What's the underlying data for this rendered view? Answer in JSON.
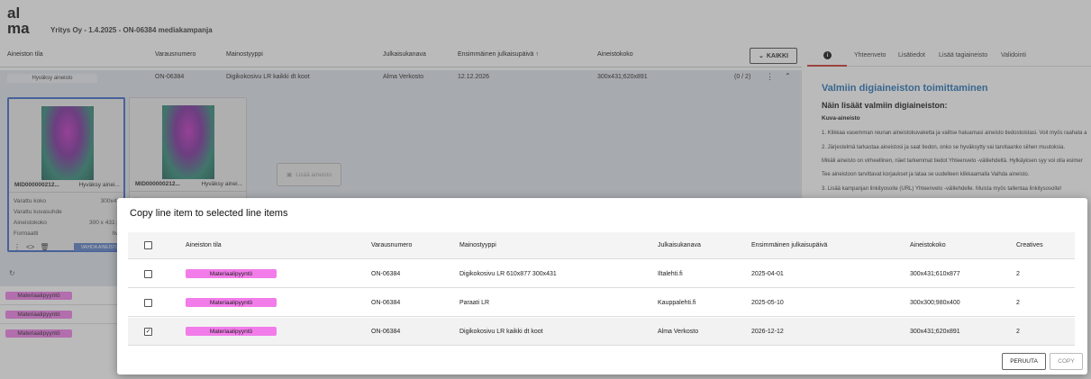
{
  "app": {
    "logo_text": "alma",
    "company_line": "Yritys Oy - 1.4.2025 - ON-06384 mediakampanja"
  },
  "columns": {
    "tila": "Aineiston tila",
    "varaus": "Varausnumero",
    "tyyppi": "Mainostyyppi",
    "kanava": "Julkaisukanava",
    "ensimmainen": "Ensimmäinen julkaisupäivä ↑",
    "koko": "Aineistokoko",
    "kaikki": "KAIKKI"
  },
  "row": {
    "status": "Hyväksy aineisto",
    "varaus": "ON-06384",
    "tyyppi": "Digikokosivu LR kaikki dt koot",
    "kanava": "Alma Verkosto",
    "date": "12.12.2026",
    "koko": "300x431;620x891",
    "count": "(0 / 2)"
  },
  "cards": [
    {
      "id": "MID000000212...",
      "approve": "Hyväksy ainei...",
      "meta": [
        {
          "label": "Varattu koko",
          "value": "300x43"
        },
        {
          "label": "Varattu kuvasuhde",
          "value": ""
        },
        {
          "label": "Aineistokoko",
          "value": "300 x 431 p"
        },
        {
          "label": "Formaatti",
          "value": "hw"
        }
      ],
      "blue_btn": "VAIHDA AINEISTO"
    },
    {
      "id": "MID000000212...",
      "approve": "Hyväksy ainei...",
      "meta": [
        {
          "label": "V",
          "value": ""
        },
        {
          "label": "V",
          "value": ""
        }
      ],
      "blue_btn": ""
    }
  ],
  "add_button": "Lisää aineisto",
  "left_pills": [
    "Materiaalipyyntö",
    "Materiaalipyyntö",
    "Materiaalipyyntö"
  ],
  "right_panel": {
    "info_glyph": "i",
    "tabs": [
      "Yhteenveto",
      "Lisätiedot",
      "Lisää tagiaineisto",
      "Validointi"
    ],
    "heading": "Valmiin digiaineiston toimittaminen",
    "subheading": "Näin lisäät valmiin digiaineiston:",
    "section": "Kuva-aineisto",
    "paragraphs": [
      "1. Klikkaa vasemman reunan aineistokuvaketta ja valitse haluamasi aineisto tiedostoistasi. Voit myös raahata a",
      "2. Järjestelmä tarkastaa aineistosi ja saat tiedon, onko se hyväksytty vai tarvitaanko siihen muutoksia.",
      "Mikäli aineisto on virheellinen, näet tarkemmat tiedot Yhteenveto -välilehdeltä. Hylkäyksen syy voi olla esimer",
      "Tee aineistoon tarvittavat korjaukset ja lataa se uudelleen klikkaamalla Vaihda aineisto.",
      "3. Lisää kampanjan linkityosoite (URL) Yhteenveto -välilehdelle. Muista myös tallentaa linkitysosoite!"
    ]
  },
  "modal": {
    "title": "Copy line item to selected line items",
    "headers": {
      "tila": "Aineiston tila",
      "varaus": "Varausnumero",
      "tyyppi": "Mainostyyppi",
      "kanava": "Julkaisukanava",
      "date": "Ensimmäinen julkaisupäivä",
      "koko": "Aineistokoko",
      "creatives": "Creatives"
    },
    "rows": [
      {
        "checked": false,
        "status": "Materiaalipyyntö",
        "varaus": "ON-06384",
        "tyyppi": "Digikokosivu LR 610x877 300x431",
        "kanava": "Iltalehti.fi",
        "date": "2025-04-01",
        "koko": "300x431;610x877",
        "creatives": "2"
      },
      {
        "checked": false,
        "status": "Materiaalipyyntö",
        "varaus": "ON-06384",
        "tyyppi": "Paraati LR",
        "kanava": "Kauppalehti.fi",
        "date": "2025-05-10",
        "koko": "300x300;980x400",
        "creatives": "2"
      },
      {
        "checked": true,
        "status": "Materiaalipyyntö",
        "varaus": "ON-06384",
        "tyyppi": "Digikokosivu LR kaikki dt koot",
        "kanava": "Alma Verkosto",
        "date": "2026-12-12",
        "koko": "300x431;620x891",
        "creatives": "2"
      }
    ],
    "cancel": "PERUUTA",
    "copy": "COPY"
  },
  "colors": {
    "accent_red": "#c9322b",
    "link_blue": "#1f6fb5",
    "pill_pink": "#f27ce9",
    "selected_border": "#3a66c8"
  }
}
